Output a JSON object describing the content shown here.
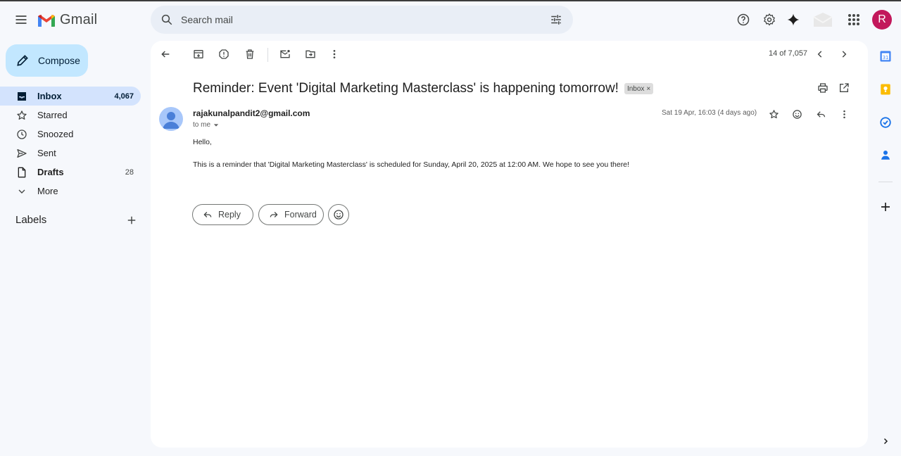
{
  "app": {
    "name": "Gmail"
  },
  "search": {
    "placeholder": "Search mail"
  },
  "account": {
    "initial": "R"
  },
  "sidebar": {
    "compose_label": "Compose",
    "items": [
      {
        "label": "Inbox",
        "count": "4,067",
        "icon": "inbox-icon"
      },
      {
        "label": "Starred",
        "count": "",
        "icon": "star-icon"
      },
      {
        "label": "Snoozed",
        "count": "",
        "icon": "clock-icon"
      },
      {
        "label": "Sent",
        "count": "",
        "icon": "send-icon"
      },
      {
        "label": "Drafts",
        "count": "28",
        "icon": "draft-icon"
      },
      {
        "label": "More",
        "count": "",
        "icon": "chevron-down-icon"
      }
    ],
    "labels_title": "Labels"
  },
  "pager": {
    "text": "14 of 7,057"
  },
  "email": {
    "subject": "Reminder: Event 'Digital Marketing Masterclass' is happening tomorrow!",
    "label_chip": "Inbox",
    "sender": "rajakunalpandit2@gmail.com",
    "recipient": "to me",
    "date": "Sat 19 Apr, 16:03 (4 days ago)",
    "greeting": "Hello,",
    "body": "This is a reminder that 'Digital Marketing Masterclass' is scheduled for Sunday, April 20, 2025 at 12:00 AM. We hope to see you there!"
  },
  "actions": {
    "reply": "Reply",
    "forward": "Forward"
  },
  "colors": {
    "accent": "#c2e7ff",
    "active_nav": "#d3e3fd",
    "avatar": "#c2185b"
  }
}
